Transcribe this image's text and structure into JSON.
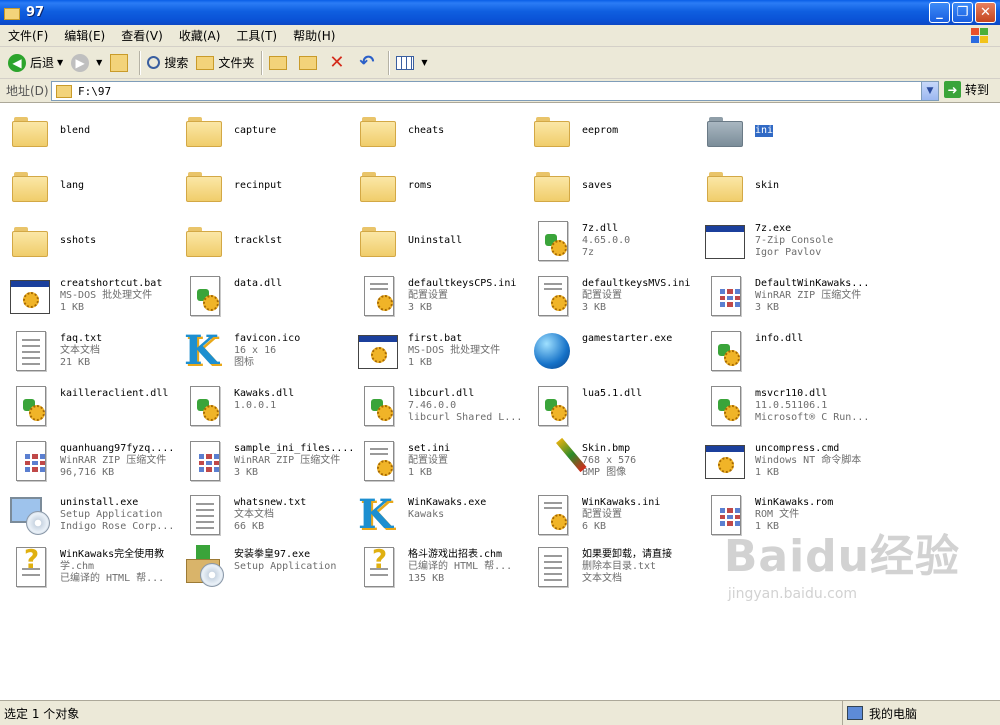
{
  "window": {
    "title": "97",
    "min_label": "_",
    "max_label": "❐",
    "close_label": "✕"
  },
  "menu": [
    "文件(F)",
    "编辑(E)",
    "查看(V)",
    "收藏(A)",
    "工具(T)",
    "帮助(H)"
  ],
  "toolbar": {
    "back": "后退",
    "search": "搜索",
    "folders": "文件夹"
  },
  "address": {
    "label": "地址(D)",
    "value": "F:\\97",
    "go": "转到"
  },
  "files": [
    {
      "name": "blend",
      "kind": "folder",
      "sub1": "",
      "sub2": ""
    },
    {
      "name": "capture",
      "kind": "folder",
      "sub1": "",
      "sub2": ""
    },
    {
      "name": "cheats",
      "kind": "folder",
      "sub1": "",
      "sub2": ""
    },
    {
      "name": "eeprom",
      "kind": "folder",
      "sub1": "",
      "sub2": ""
    },
    {
      "name": "ini",
      "kind": "folder-selected",
      "sub1": "",
      "sub2": ""
    },
    {
      "name": "lang",
      "kind": "folder",
      "sub1": "",
      "sub2": ""
    },
    {
      "name": "recinput",
      "kind": "folder",
      "sub1": "",
      "sub2": ""
    },
    {
      "name": "roms",
      "kind": "folder",
      "sub1": "",
      "sub2": ""
    },
    {
      "name": "saves",
      "kind": "folder",
      "sub1": "",
      "sub2": ""
    },
    {
      "name": "skin",
      "kind": "folder",
      "sub1": "",
      "sub2": ""
    },
    {
      "name": "sshots",
      "kind": "folder",
      "sub1": "",
      "sub2": ""
    },
    {
      "name": "tracklst",
      "kind": "folder",
      "sub1": "",
      "sub2": ""
    },
    {
      "name": "Uninstall",
      "kind": "folder",
      "sub1": "",
      "sub2": ""
    },
    {
      "name": "7z.dll",
      "kind": "dll",
      "sub1": "4.65.0.0",
      "sub2": "7z"
    },
    {
      "name": "7z.exe",
      "kind": "window",
      "sub1": "7-Zip Console",
      "sub2": "Igor Pavlov"
    },
    {
      "name": "creatshortcut.bat",
      "kind": "bat",
      "sub1": "MS-DOS 批处理文件",
      "sub2": "1 KB"
    },
    {
      "name": "data.dll",
      "kind": "dll",
      "sub1": "",
      "sub2": ""
    },
    {
      "name": "defaultkeysCPS.ini",
      "kind": "ini",
      "sub1": "配置设置",
      "sub2": "3 KB"
    },
    {
      "name": "defaultkeysMVS.ini",
      "kind": "ini",
      "sub1": "配置设置",
      "sub2": "3 KB"
    },
    {
      "name": "DefaultWinKawaks...",
      "kind": "zip",
      "sub1": "WinRAR ZIP 压缩文件",
      "sub2": "3 KB"
    },
    {
      "name": "faq.txt",
      "kind": "txt",
      "sub1": "文本文档",
      "sub2": "21 KB"
    },
    {
      "name": "favicon.ico",
      "kind": "kawaks",
      "sub1": "16 x 16",
      "sub2": "图标"
    },
    {
      "name": "first.bat",
      "kind": "bat",
      "sub1": "MS-DOS 批处理文件",
      "sub2": "1 KB"
    },
    {
      "name": "gamestarter.exe",
      "kind": "globe",
      "sub1": "",
      "sub2": ""
    },
    {
      "name": "info.dll",
      "kind": "dll",
      "sub1": "",
      "sub2": ""
    },
    {
      "name": "kailleraclient.dll",
      "kind": "dll",
      "sub1": "",
      "sub2": ""
    },
    {
      "name": "Kawaks.dll",
      "kind": "dll",
      "sub1": "1.0.0.1",
      "sub2": ""
    },
    {
      "name": "libcurl.dll",
      "kind": "dll",
      "sub1": "7.46.0.0",
      "sub2": "libcurl Shared L..."
    },
    {
      "name": "lua5.1.dll",
      "kind": "dll",
      "sub1": "",
      "sub2": ""
    },
    {
      "name": "msvcr110.dll",
      "kind": "dll",
      "sub1": "11.0.51106.1",
      "sub2": "Microsoft® C Run..."
    },
    {
      "name": "quanhuang97fyzq....",
      "kind": "zip",
      "sub1": "WinRAR ZIP 压缩文件",
      "sub2": "96,716 KB"
    },
    {
      "name": "sample_ini_files....",
      "kind": "zip",
      "sub1": "WinRAR ZIP 压缩文件",
      "sub2": "3 KB"
    },
    {
      "name": "set.ini",
      "kind": "ini",
      "sub1": "配置设置",
      "sub2": "1 KB"
    },
    {
      "name": "Skin.bmp",
      "kind": "brush",
      "sub1": "768 x 576",
      "sub2": "BMP 图像"
    },
    {
      "name": "uncompress.cmd",
      "kind": "bat",
      "sub1": "Windows NT 命令脚本",
      "sub2": "1 KB"
    },
    {
      "name": "uninstall.exe",
      "kind": "monitor",
      "sub1": "Setup Application",
      "sub2": "Indigo Rose Corp..."
    },
    {
      "name": "whatsnew.txt",
      "kind": "txt",
      "sub1": "文本文档",
      "sub2": "66 KB"
    },
    {
      "name": "WinKawaks.exe",
      "kind": "kawaks",
      "sub1": "Kawaks",
      "sub2": ""
    },
    {
      "name": "WinKawaks.ini",
      "kind": "ini",
      "sub1": "配置设置",
      "sub2": "6 KB"
    },
    {
      "name": "WinKawaks.rom",
      "kind": "zip",
      "sub1": "ROM 文件",
      "sub2": "1 KB"
    },
    {
      "name": "WinKawaks完全使用教",
      "kind": "chm",
      "sub1": "学.chm",
      "sub2": "已编译的 HTML 帮..."
    },
    {
      "name": "安装拳皇97.exe",
      "kind": "setup",
      "sub1": "Setup Application",
      "sub2": ""
    },
    {
      "name": "格斗游戏出招表.chm",
      "kind": "chm",
      "sub1": "已编译的 HTML 帮...",
      "sub2": "135 KB"
    },
    {
      "name": "如果要卸载，请直接",
      "kind": "txt",
      "sub1": "删除本目录.txt",
      "sub2": "文本文档"
    }
  ],
  "watermark": {
    "big": "Baidu经验",
    "small": "jingyan.baidu.com"
  },
  "status": {
    "left": "选定 1 个对象",
    "right": "我的电脑"
  }
}
